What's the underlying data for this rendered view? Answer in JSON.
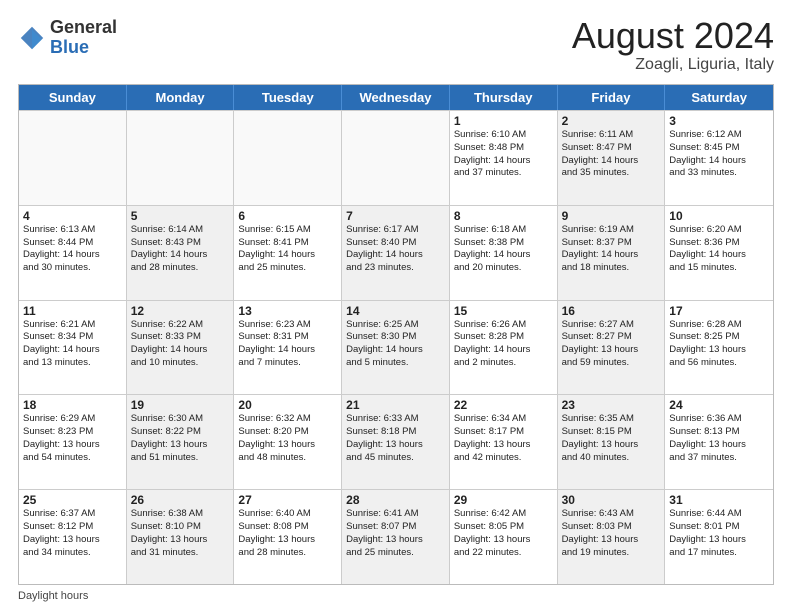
{
  "header": {
    "logo_general": "General",
    "logo_blue": "Blue",
    "month_title": "August 2024",
    "location": "Zoagli, Liguria, Italy"
  },
  "days_of_week": [
    "Sunday",
    "Monday",
    "Tuesday",
    "Wednesday",
    "Thursday",
    "Friday",
    "Saturday"
  ],
  "footer_label": "Daylight hours",
  "rows": [
    [
      {
        "day": "",
        "info": "",
        "shaded": false,
        "empty": true
      },
      {
        "day": "",
        "info": "",
        "shaded": false,
        "empty": true
      },
      {
        "day": "",
        "info": "",
        "shaded": false,
        "empty": true
      },
      {
        "day": "",
        "info": "",
        "shaded": false,
        "empty": true
      },
      {
        "day": "1",
        "info": "Sunrise: 6:10 AM\nSunset: 8:48 PM\nDaylight: 14 hours\nand 37 minutes.",
        "shaded": false,
        "empty": false
      },
      {
        "day": "2",
        "info": "Sunrise: 6:11 AM\nSunset: 8:47 PM\nDaylight: 14 hours\nand 35 minutes.",
        "shaded": true,
        "empty": false
      },
      {
        "day": "3",
        "info": "Sunrise: 6:12 AM\nSunset: 8:45 PM\nDaylight: 14 hours\nand 33 minutes.",
        "shaded": false,
        "empty": false
      }
    ],
    [
      {
        "day": "4",
        "info": "Sunrise: 6:13 AM\nSunset: 8:44 PM\nDaylight: 14 hours\nand 30 minutes.",
        "shaded": false,
        "empty": false
      },
      {
        "day": "5",
        "info": "Sunrise: 6:14 AM\nSunset: 8:43 PM\nDaylight: 14 hours\nand 28 minutes.",
        "shaded": true,
        "empty": false
      },
      {
        "day": "6",
        "info": "Sunrise: 6:15 AM\nSunset: 8:41 PM\nDaylight: 14 hours\nand 25 minutes.",
        "shaded": false,
        "empty": false
      },
      {
        "day": "7",
        "info": "Sunrise: 6:17 AM\nSunset: 8:40 PM\nDaylight: 14 hours\nand 23 minutes.",
        "shaded": true,
        "empty": false
      },
      {
        "day": "8",
        "info": "Sunrise: 6:18 AM\nSunset: 8:38 PM\nDaylight: 14 hours\nand 20 minutes.",
        "shaded": false,
        "empty": false
      },
      {
        "day": "9",
        "info": "Sunrise: 6:19 AM\nSunset: 8:37 PM\nDaylight: 14 hours\nand 18 minutes.",
        "shaded": true,
        "empty": false
      },
      {
        "day": "10",
        "info": "Sunrise: 6:20 AM\nSunset: 8:36 PM\nDaylight: 14 hours\nand 15 minutes.",
        "shaded": false,
        "empty": false
      }
    ],
    [
      {
        "day": "11",
        "info": "Sunrise: 6:21 AM\nSunset: 8:34 PM\nDaylight: 14 hours\nand 13 minutes.",
        "shaded": false,
        "empty": false
      },
      {
        "day": "12",
        "info": "Sunrise: 6:22 AM\nSunset: 8:33 PM\nDaylight: 14 hours\nand 10 minutes.",
        "shaded": true,
        "empty": false
      },
      {
        "day": "13",
        "info": "Sunrise: 6:23 AM\nSunset: 8:31 PM\nDaylight: 14 hours\nand 7 minutes.",
        "shaded": false,
        "empty": false
      },
      {
        "day": "14",
        "info": "Sunrise: 6:25 AM\nSunset: 8:30 PM\nDaylight: 14 hours\nand 5 minutes.",
        "shaded": true,
        "empty": false
      },
      {
        "day": "15",
        "info": "Sunrise: 6:26 AM\nSunset: 8:28 PM\nDaylight: 14 hours\nand 2 minutes.",
        "shaded": false,
        "empty": false
      },
      {
        "day": "16",
        "info": "Sunrise: 6:27 AM\nSunset: 8:27 PM\nDaylight: 13 hours\nand 59 minutes.",
        "shaded": true,
        "empty": false
      },
      {
        "day": "17",
        "info": "Sunrise: 6:28 AM\nSunset: 8:25 PM\nDaylight: 13 hours\nand 56 minutes.",
        "shaded": false,
        "empty": false
      }
    ],
    [
      {
        "day": "18",
        "info": "Sunrise: 6:29 AM\nSunset: 8:23 PM\nDaylight: 13 hours\nand 54 minutes.",
        "shaded": false,
        "empty": false
      },
      {
        "day": "19",
        "info": "Sunrise: 6:30 AM\nSunset: 8:22 PM\nDaylight: 13 hours\nand 51 minutes.",
        "shaded": true,
        "empty": false
      },
      {
        "day": "20",
        "info": "Sunrise: 6:32 AM\nSunset: 8:20 PM\nDaylight: 13 hours\nand 48 minutes.",
        "shaded": false,
        "empty": false
      },
      {
        "day": "21",
        "info": "Sunrise: 6:33 AM\nSunset: 8:18 PM\nDaylight: 13 hours\nand 45 minutes.",
        "shaded": true,
        "empty": false
      },
      {
        "day": "22",
        "info": "Sunrise: 6:34 AM\nSunset: 8:17 PM\nDaylight: 13 hours\nand 42 minutes.",
        "shaded": false,
        "empty": false
      },
      {
        "day": "23",
        "info": "Sunrise: 6:35 AM\nSunset: 8:15 PM\nDaylight: 13 hours\nand 40 minutes.",
        "shaded": true,
        "empty": false
      },
      {
        "day": "24",
        "info": "Sunrise: 6:36 AM\nSunset: 8:13 PM\nDaylight: 13 hours\nand 37 minutes.",
        "shaded": false,
        "empty": false
      }
    ],
    [
      {
        "day": "25",
        "info": "Sunrise: 6:37 AM\nSunset: 8:12 PM\nDaylight: 13 hours\nand 34 minutes.",
        "shaded": false,
        "empty": false
      },
      {
        "day": "26",
        "info": "Sunrise: 6:38 AM\nSunset: 8:10 PM\nDaylight: 13 hours\nand 31 minutes.",
        "shaded": true,
        "empty": false
      },
      {
        "day": "27",
        "info": "Sunrise: 6:40 AM\nSunset: 8:08 PM\nDaylight: 13 hours\nand 28 minutes.",
        "shaded": false,
        "empty": false
      },
      {
        "day": "28",
        "info": "Sunrise: 6:41 AM\nSunset: 8:07 PM\nDaylight: 13 hours\nand 25 minutes.",
        "shaded": true,
        "empty": false
      },
      {
        "day": "29",
        "info": "Sunrise: 6:42 AM\nSunset: 8:05 PM\nDaylight: 13 hours\nand 22 minutes.",
        "shaded": false,
        "empty": false
      },
      {
        "day": "30",
        "info": "Sunrise: 6:43 AM\nSunset: 8:03 PM\nDaylight: 13 hours\nand 19 minutes.",
        "shaded": true,
        "empty": false
      },
      {
        "day": "31",
        "info": "Sunrise: 6:44 AM\nSunset: 8:01 PM\nDaylight: 13 hours\nand 17 minutes.",
        "shaded": false,
        "empty": false
      }
    ]
  ]
}
